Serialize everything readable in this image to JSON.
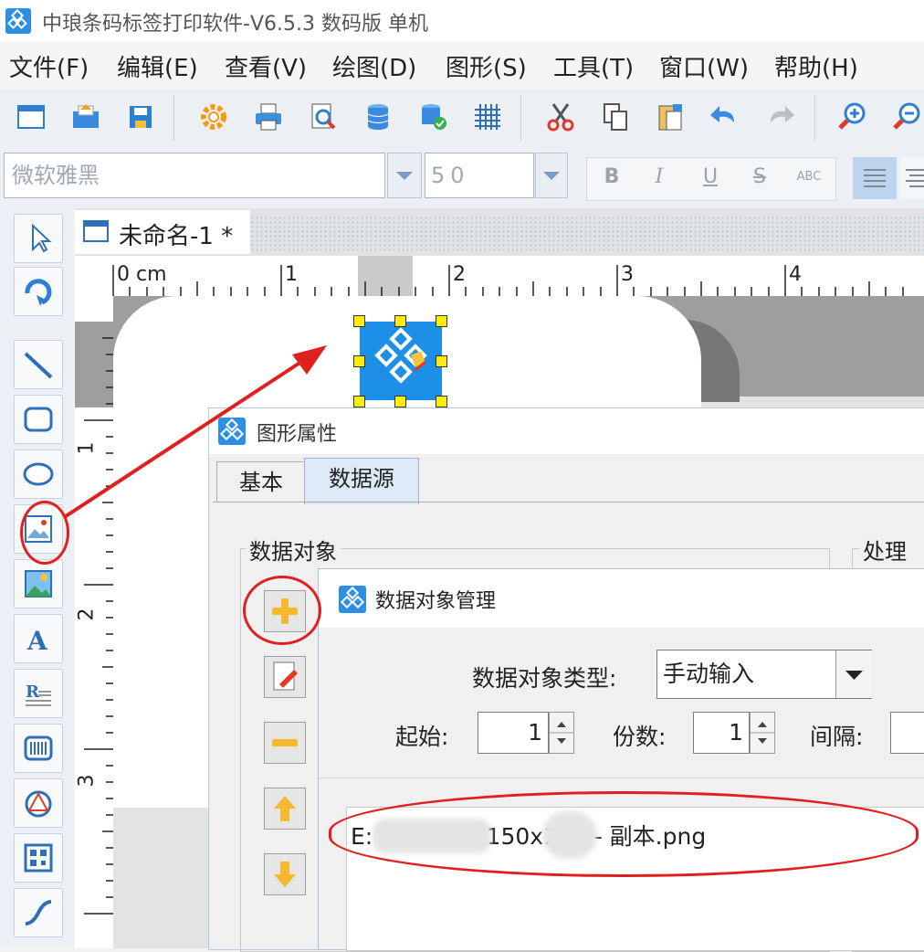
{
  "app": {
    "title": "中琅条码标签打印软件-V6.5.3 数码版 单机"
  },
  "menu": [
    "文件(F)",
    "编辑(E)",
    "查看(V)",
    "绘图(D)",
    "图形(S)",
    "工具(T)",
    "窗口(W)",
    "帮助(H)"
  ],
  "toolbar_icons": [
    "new-icon",
    "open-icon",
    "save-icon",
    "settings-icon",
    "print-icon",
    "print-preview-icon",
    "database-icon",
    "database-connect-icon",
    "grid-icon",
    "cut-icon",
    "copy-icon",
    "paste-icon",
    "undo-icon",
    "redo-icon",
    "zoom-in-icon",
    "zoom-out-icon"
  ],
  "fontbar": {
    "font_name": "微软雅黑",
    "font_size": "50",
    "bold": "B",
    "italic": "I",
    "underline": "U",
    "strike": "S",
    "superscript": "ABC"
  },
  "document": {
    "tab_title": "未命名-1 *",
    "ruler_h": [
      "0 cm",
      "1",
      "2",
      "3",
      "4"
    ],
    "ruler_v": [
      "1",
      "2",
      "3"
    ]
  },
  "prop_dialog": {
    "title": "图形属性",
    "tabs": [
      "基本",
      "数据源"
    ],
    "group_data_objects": "数据对象",
    "group_processing": "处理ス"
  },
  "mgr_dialog": {
    "title": "数据对象管理",
    "type_label": "数据对象类型:",
    "type_value": "手动输入",
    "start_label": "起始:",
    "start_value": "1",
    "copies_label": "份数:",
    "copies_value": "1",
    "interval_label": "间隔:",
    "list_item": "E:          图片\\      图标150x150 - 副本.png"
  },
  "colors": {
    "accent": "#2d8ee6",
    "annotation_red": "#e0201e",
    "handle_yellow": "#ffed00"
  }
}
